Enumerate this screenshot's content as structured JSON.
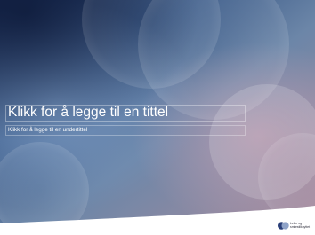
{
  "slide": {
    "title_placeholder": "Klikk for å legge til en tittel",
    "subtitle_placeholder": "Klikk for å legge til en undertittel"
  },
  "logo": {
    "line1": "Leiter og",
    "line2": "smilestilknyttet"
  },
  "colors": {
    "bg_dark": "#1c2c52",
    "bg_blue": "#5a7aa6",
    "bg_mauve": "#a48a9c",
    "logo_blue": "#2a3f78",
    "logo_light": "#8fa3c8"
  }
}
